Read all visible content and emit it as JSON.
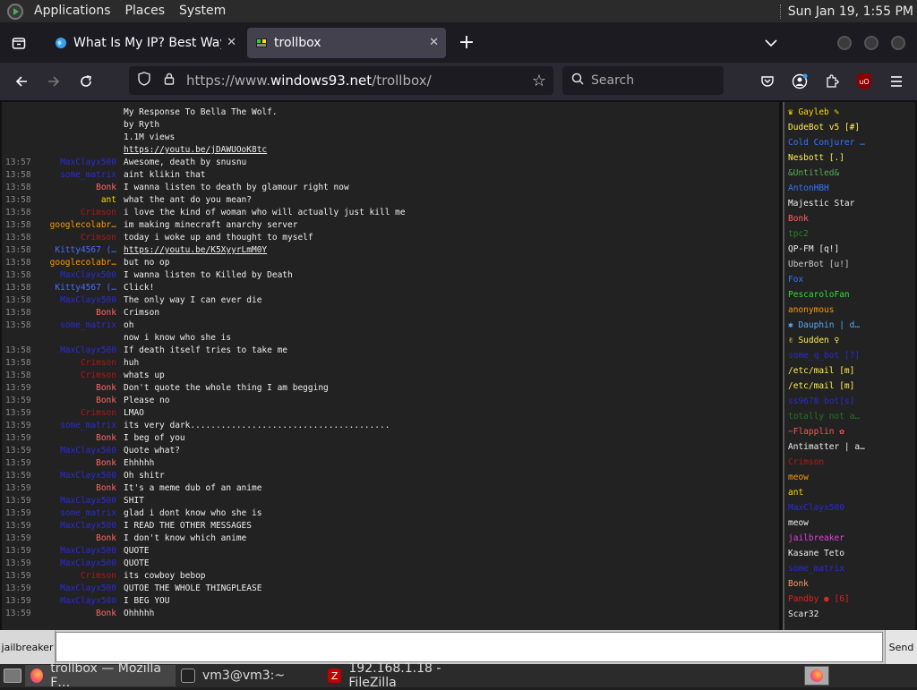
{
  "panel": {
    "applications": "Applications",
    "places": "Places",
    "system": "System",
    "clock": "Sun Jan 19,  1:55 PM"
  },
  "tabs": [
    {
      "title": "What Is My IP? Best Way To",
      "close": "✕",
      "active": false
    },
    {
      "title": "trollbox",
      "close": "✕",
      "active": true
    }
  ],
  "new_tab": "+",
  "nav": {
    "url_prefix": "https://www.",
    "url_domain": "windows93.net",
    "url_path": "/trollbox/",
    "search_placeholder": "Search"
  },
  "colors": {
    "default_nick": "#5555ff"
  },
  "chat": [
    {
      "time": "",
      "nick": "",
      "color": "#5555ff",
      "text": "My Response To Bella The Wolf.",
      "link": false
    },
    {
      "time": "",
      "nick": "",
      "color": "#5555ff",
      "text": "by Ryth",
      "link": false
    },
    {
      "time": "",
      "nick": "",
      "color": "#5555ff",
      "text": "1.1M views",
      "link": false
    },
    {
      "time": "",
      "nick": "",
      "color": "#5555ff",
      "text": "https://youtu.be/jDAWUOoK8tc",
      "link": true
    },
    {
      "time": "13:57",
      "nick": "MaxClayx500",
      "color": "#2b2bd6",
      "text": "Awesome, death by snusnu",
      "link": false
    },
    {
      "time": "13:58",
      "nick": "some_matrix",
      "color": "#2b2bd6",
      "text": "aint klikin that",
      "link": false
    },
    {
      "time": "13:58",
      "nick": "Bonk",
      "color": "#ff6666",
      "text": "I wanna listen to death by glamour right now",
      "link": false
    },
    {
      "time": "13:58",
      "nick": "ant",
      "color": "#ffd700",
      "text": "what the ant do you mean?",
      "link": false
    },
    {
      "time": "13:58",
      "nick": "Crimson",
      "color": "#b01818",
      "text": "i love the kind of woman who will actually just kill me",
      "link": false
    },
    {
      "time": "13:58",
      "nick": "googlecolabr…",
      "color": "#ff9900",
      "text": "im making minecraft anarchy server",
      "link": false
    },
    {
      "time": "13:58",
      "nick": "Crimson",
      "color": "#b01818",
      "text": "today i woke up and thought to myself",
      "link": false
    },
    {
      "time": "13:58",
      "nick": "Kitty4567 (…",
      "color": "#4a6cff",
      "text": "https://youtu.be/K5XyyrLmM0Y",
      "link": true
    },
    {
      "time": "13:58",
      "nick": "googlecolabr…",
      "color": "#ff9900",
      "text": "but no op",
      "link": false
    },
    {
      "time": "13:58",
      "nick": "MaxClayx500",
      "color": "#2b2bd6",
      "text": "I wanna listen to Killed by Death",
      "link": false
    },
    {
      "time": "13:58",
      "nick": "Kitty4567 (…",
      "color": "#4a6cff",
      "text": "Click!",
      "link": false
    },
    {
      "time": "13:58",
      "nick": "MaxClayx500",
      "color": "#2b2bd6",
      "text": "The only way I can ever die",
      "link": false
    },
    {
      "time": "13:58",
      "nick": "Bonk",
      "color": "#ff6666",
      "text": "Crimson",
      "link": false
    },
    {
      "time": "13:58",
      "nick": "some_matrix",
      "color": "#2b2bd6",
      "text": "oh",
      "link": false
    },
    {
      "time": "",
      "nick": "",
      "color": "#5555ff",
      "text": "now i know who she is",
      "link": false
    },
    {
      "time": "13:58",
      "nick": "MaxClayx500",
      "color": "#2b2bd6",
      "text": "If death itself tries to take me",
      "link": false
    },
    {
      "time": "13:58",
      "nick": "Crimson",
      "color": "#b01818",
      "text": "huh",
      "link": false
    },
    {
      "time": "13:58",
      "nick": "Crimson",
      "color": "#b01818",
      "text": "whats up",
      "link": false
    },
    {
      "time": "13:59",
      "nick": "Bonk",
      "color": "#ff6666",
      "text": "Don't quote the whole thing I am begging",
      "link": false
    },
    {
      "time": "13:59",
      "nick": "Bonk",
      "color": "#ff6666",
      "text": "Please no",
      "link": false
    },
    {
      "time": "13:59",
      "nick": "Crimson",
      "color": "#b01818",
      "text": "LMAO",
      "link": false
    },
    {
      "time": "13:59",
      "nick": "some_matrix",
      "color": "#2b2bd6",
      "text": "its very dark.......................................",
      "link": false
    },
    {
      "time": "13:59",
      "nick": "Bonk",
      "color": "#ff6666",
      "text": "I beg of you",
      "link": false
    },
    {
      "time": "13:59",
      "nick": "MaxClayx500",
      "color": "#2b2bd6",
      "text": "Quote what?",
      "link": false
    },
    {
      "time": "13:59",
      "nick": "Bonk",
      "color": "#ff6666",
      "text": "Ehhhhh",
      "link": false
    },
    {
      "time": "13:59",
      "nick": "MaxClayx500",
      "color": "#2b2bd6",
      "text": "Oh shitr",
      "link": false
    },
    {
      "time": "13:59",
      "nick": "Bonk",
      "color": "#ff6666",
      "text": "It's a meme dub of an anime",
      "link": false
    },
    {
      "time": "13:59",
      "nick": "MaxClayx500",
      "color": "#2b2bd6",
      "text": "SHIT",
      "link": false
    },
    {
      "time": "13:59",
      "nick": "some_matrix",
      "color": "#2b2bd6",
      "text": "glad i dont know who she is",
      "link": false
    },
    {
      "time": "13:59",
      "nick": "MaxClayx500",
      "color": "#2b2bd6",
      "text": "I READ THE OTHER MESSAGES",
      "link": false
    },
    {
      "time": "13:59",
      "nick": "Bonk",
      "color": "#ff6666",
      "text": "I don't know which anime",
      "link": false
    },
    {
      "time": "13:59",
      "nick": "MaxClayx500",
      "color": "#2b2bd6",
      "text": "QUOTE",
      "link": false
    },
    {
      "time": "13:59",
      "nick": "MaxClayx500",
      "color": "#2b2bd6",
      "text": "QUOTE",
      "link": false
    },
    {
      "time": "13:59",
      "nick": "Crimson",
      "color": "#b01818",
      "text": "its cowboy bebop",
      "link": false
    },
    {
      "time": "13:59",
      "nick": "MaxClayx500",
      "color": "#2b2bd6",
      "text": "QUTOE THE WHOLE THINGPLEASE",
      "link": false
    },
    {
      "time": "13:59",
      "nick": "MaxClayx500",
      "color": "#2b2bd6",
      "text": "I BEG YOU",
      "link": false
    },
    {
      "time": "13:59",
      "nick": "Bonk",
      "color": "#ff6666",
      "text": "Ohhhhh",
      "link": false
    }
  ],
  "users": [
    {
      "name": "♛ Gayleb ✎",
      "color": "#ffd700"
    },
    {
      "name": "DudeBot v5 [#]",
      "color": "#ffee55"
    },
    {
      "name": "Cold Conjurer …",
      "color": "#3377ff"
    },
    {
      "name": "Nesbott [.]",
      "color": "#ffee55"
    },
    {
      "name": "&Untitled&",
      "color": "#55aa55"
    },
    {
      "name": "AntonHBH",
      "color": "#3377ff"
    },
    {
      "name": "Majestic Star",
      "color": "#eeeeee"
    },
    {
      "name": "Bonk",
      "color": "#ff6666"
    },
    {
      "name": "tpc2",
      "color": "#228822"
    },
    {
      "name": "QP-FM [q!]",
      "color": "#eeeeee"
    },
    {
      "name": "UberBot [u!]",
      "color": "#cccccc"
    },
    {
      "name": "Fox",
      "color": "#3377ff"
    },
    {
      "name": "PescaroloFan",
      "color": "#33dd33"
    },
    {
      "name": "anonymous",
      "color": "#ff9900"
    },
    {
      "name": "✱ Dauphin | d…",
      "color": "#55aaff"
    },
    {
      "name": "✌ Sudden ♀",
      "color": "#ffee55"
    },
    {
      "name": "some_q_bot [?]",
      "color": "#2b2bd6"
    },
    {
      "name": "/etc/mail [m]",
      "color": "#ffee55"
    },
    {
      "name": "/etc/mail [m]",
      "color": "#ffee55"
    },
    {
      "name": "ss9678 bot[s]",
      "color": "#2b2bd6"
    },
    {
      "name": "totally not a…",
      "color": "#227722"
    },
    {
      "name": "~Flapplin ✿",
      "color": "#ff5555"
    },
    {
      "name": "Antimatter | a…",
      "color": "#eeeeee"
    },
    {
      "name": "Crimson",
      "color": "#b01818"
    },
    {
      "name": "meow",
      "color": "#ff9900"
    },
    {
      "name": "ant",
      "color": "#ffd700"
    },
    {
      "name": "MaxClayx500",
      "color": "#2b2bd6"
    },
    {
      "name": "meow",
      "color": "#eeeeee"
    },
    {
      "name": "jailbreaker",
      "color": "#dd44dd"
    },
    {
      "name": "Kasane Teto",
      "color": "#eeeeee"
    },
    {
      "name": "some_matrix",
      "color": "#2b2bd6"
    },
    {
      "name": "Bonk",
      "color": "#ff9966"
    },
    {
      "name": "Pandby ● [6]",
      "color": "#dd2222"
    },
    {
      "name": "Scar32",
      "color": "#eeeeee"
    }
  ],
  "input": {
    "nick": "jailbreaker",
    "value": "",
    "send": "Send"
  },
  "taskbar": {
    "items": [
      {
        "label": "trollbox — Mozilla F…",
        "active": true
      },
      {
        "label": "vm3@vm3:~",
        "active": false
      },
      {
        "label": "192.168.1.18 - FileZilla",
        "active": false
      }
    ]
  }
}
